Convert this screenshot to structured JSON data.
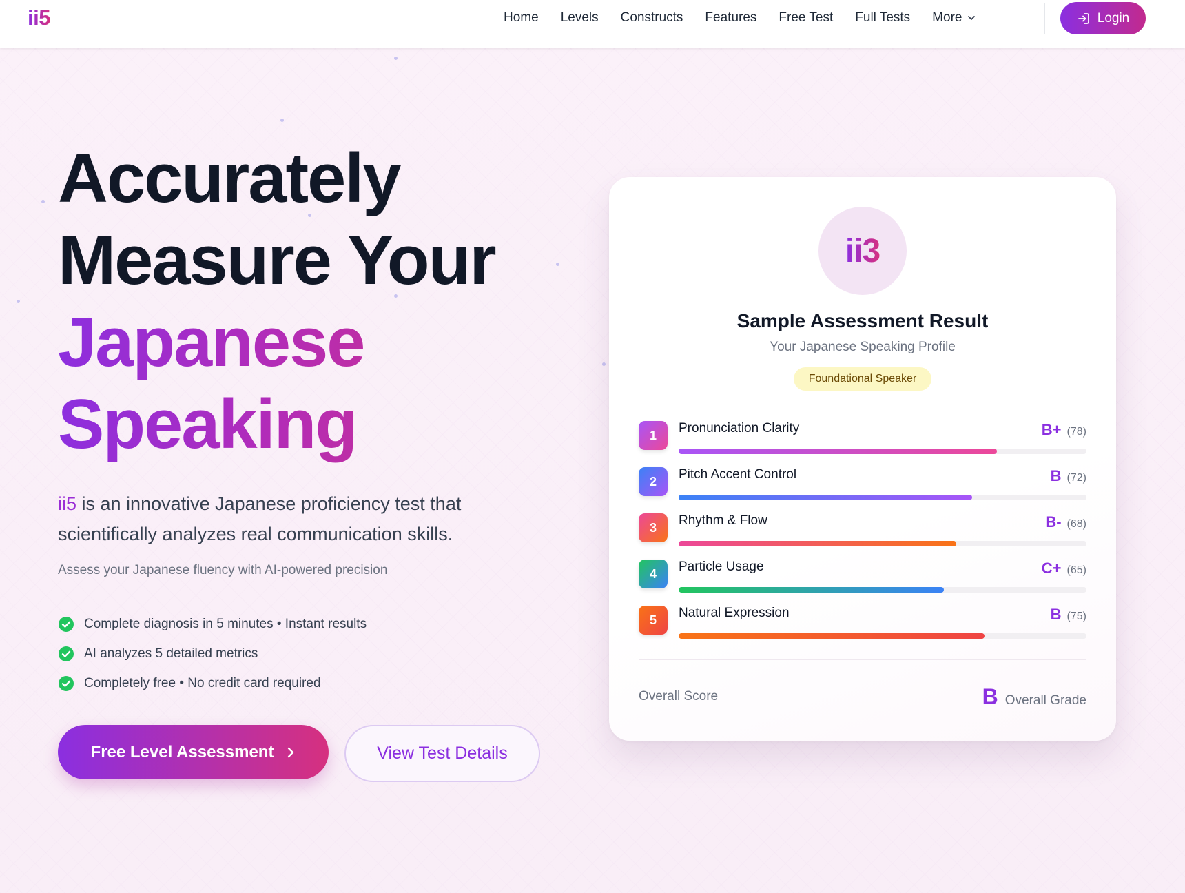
{
  "header": {
    "logo": "ii5",
    "nav": [
      {
        "label": "Home"
      },
      {
        "label": "Levels"
      },
      {
        "label": "Constructs"
      },
      {
        "label": "Features"
      },
      {
        "label": "Free Test"
      },
      {
        "label": "Full Tests"
      },
      {
        "label": "More",
        "icon": "chevron-down-icon"
      }
    ],
    "login_label": "Login",
    "login_icon": "login-icon"
  },
  "hero": {
    "title_line1": "Accurately",
    "title_line2": "Measure Your",
    "title_line3": "Japanese",
    "title_line4": "Speaking",
    "lead_brand": "ii5",
    "lead_text": " is an innovative Japanese proficiency test that scientifically analyzes real communication skills.",
    "subtitle": "Assess your Japanese fluency with AI-powered precision",
    "checks": [
      "Complete diagnosis in 5 minutes • Instant results",
      "AI analyzes 5 detailed metrics",
      "Completely free • No credit card required"
    ],
    "primary_button": "Free Level Assessment",
    "secondary_button": "View Test Details"
  },
  "card": {
    "logo": "ii3",
    "title": "Sample Assessment Result",
    "subtitle": "Your Japanese Speaking Profile",
    "badge": "Foundational Speaker",
    "metrics": [
      {
        "num": "1",
        "label": "Pronunciation Clarity",
        "grade": "B+",
        "score": "(78)",
        "value": 78
      },
      {
        "num": "2",
        "label": "Pitch Accent Control",
        "grade": "B",
        "score": "(72)",
        "value": 72
      },
      {
        "num": "3",
        "label": "Rhythm & Flow",
        "grade": "B-",
        "score": "(68)",
        "value": 68
      },
      {
        "num": "4",
        "label": "Particle Usage",
        "grade": "C+",
        "score": "(65)",
        "value": 65
      },
      {
        "num": "5",
        "label": "Natural Expression",
        "grade": "B",
        "score": "(75)",
        "value": 75
      }
    ],
    "overall_label": "Overall Score",
    "overall_grade": "B",
    "overall_grade_label": "Overall Grade"
  },
  "colors": {
    "brand_purple": "#8b2fe0",
    "brand_pink": "#d6307f",
    "badge_bg": "#fcf7c4",
    "check_green": "#22c55e",
    "metric_gradients": [
      [
        "#a855f7",
        "#ec4899"
      ],
      [
        "#3b82f6",
        "#a855f7"
      ],
      [
        "#ec4899",
        "#f97316"
      ],
      [
        "#22c55e",
        "#3b82f6"
      ],
      [
        "#f97316",
        "#ef4444"
      ]
    ]
  }
}
